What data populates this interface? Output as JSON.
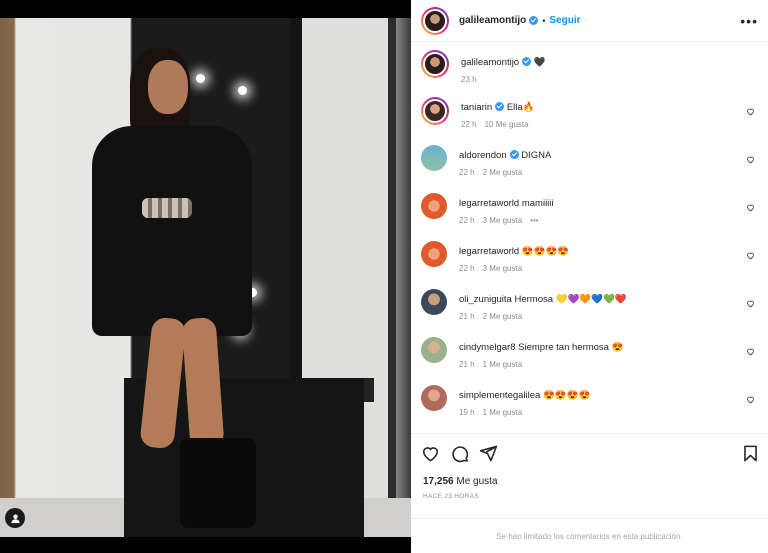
{
  "post": {
    "username": "galileamontijo",
    "follow_label": "Seguir",
    "separator": "•",
    "caption_username": "galileamontijo",
    "caption_emoji": "🖤",
    "caption_time": "23 h"
  },
  "comments": [
    {
      "user": "taniarin",
      "verified": true,
      "text": "Ella🔥",
      "time": "22 h",
      "likes": "10 Me gusta",
      "extra": ""
    },
    {
      "user": "aldorendon",
      "verified": true,
      "text": "DIGNA",
      "time": "22 h",
      "likes": "2 Me gusta",
      "extra": ""
    },
    {
      "user": "legarretaworld",
      "verified": false,
      "text": "mamiiiii",
      "time": "22 h",
      "likes": "3 Me gusta",
      "extra": "•••"
    },
    {
      "user": "legarretaworld",
      "verified": false,
      "text": "😍😍😍😍",
      "time": "22 h",
      "likes": "3 Me gusta",
      "extra": ""
    },
    {
      "user": "oli_zuniguita",
      "verified": false,
      "text": "Hermosa 💛💜🧡💙💚❤️",
      "time": "21 h",
      "likes": "2 Me gusta",
      "extra": ""
    },
    {
      "user": "cindymelgar8",
      "verified": false,
      "text": "Siempre tan hermosa 😍",
      "time": "21 h",
      "likes": "1 Me gusta",
      "extra": ""
    },
    {
      "user": "simplementegalilea",
      "verified": false,
      "text": "😍😍😍😍",
      "time": "19 h",
      "likes": "1 Me gusta",
      "extra": ""
    }
  ],
  "stats": {
    "likes_count": "17,256",
    "likes_label": "Me gusta",
    "posted_ago": "HACE 23 HORAS"
  },
  "footer": {
    "comments_limited": "Se han limitado los comentarios en esta publicación."
  },
  "icons": {
    "more": "more-options-icon",
    "like": "heart-icon",
    "comment": "comment-icon",
    "share": "share-icon",
    "save": "bookmark-icon",
    "verified": "verified-badge-icon",
    "tagged_user": "user-icon"
  },
  "colors": {
    "link_blue": "#0095f6",
    "verified_blue": "#3897f0",
    "muted": "#8e8e8e"
  }
}
